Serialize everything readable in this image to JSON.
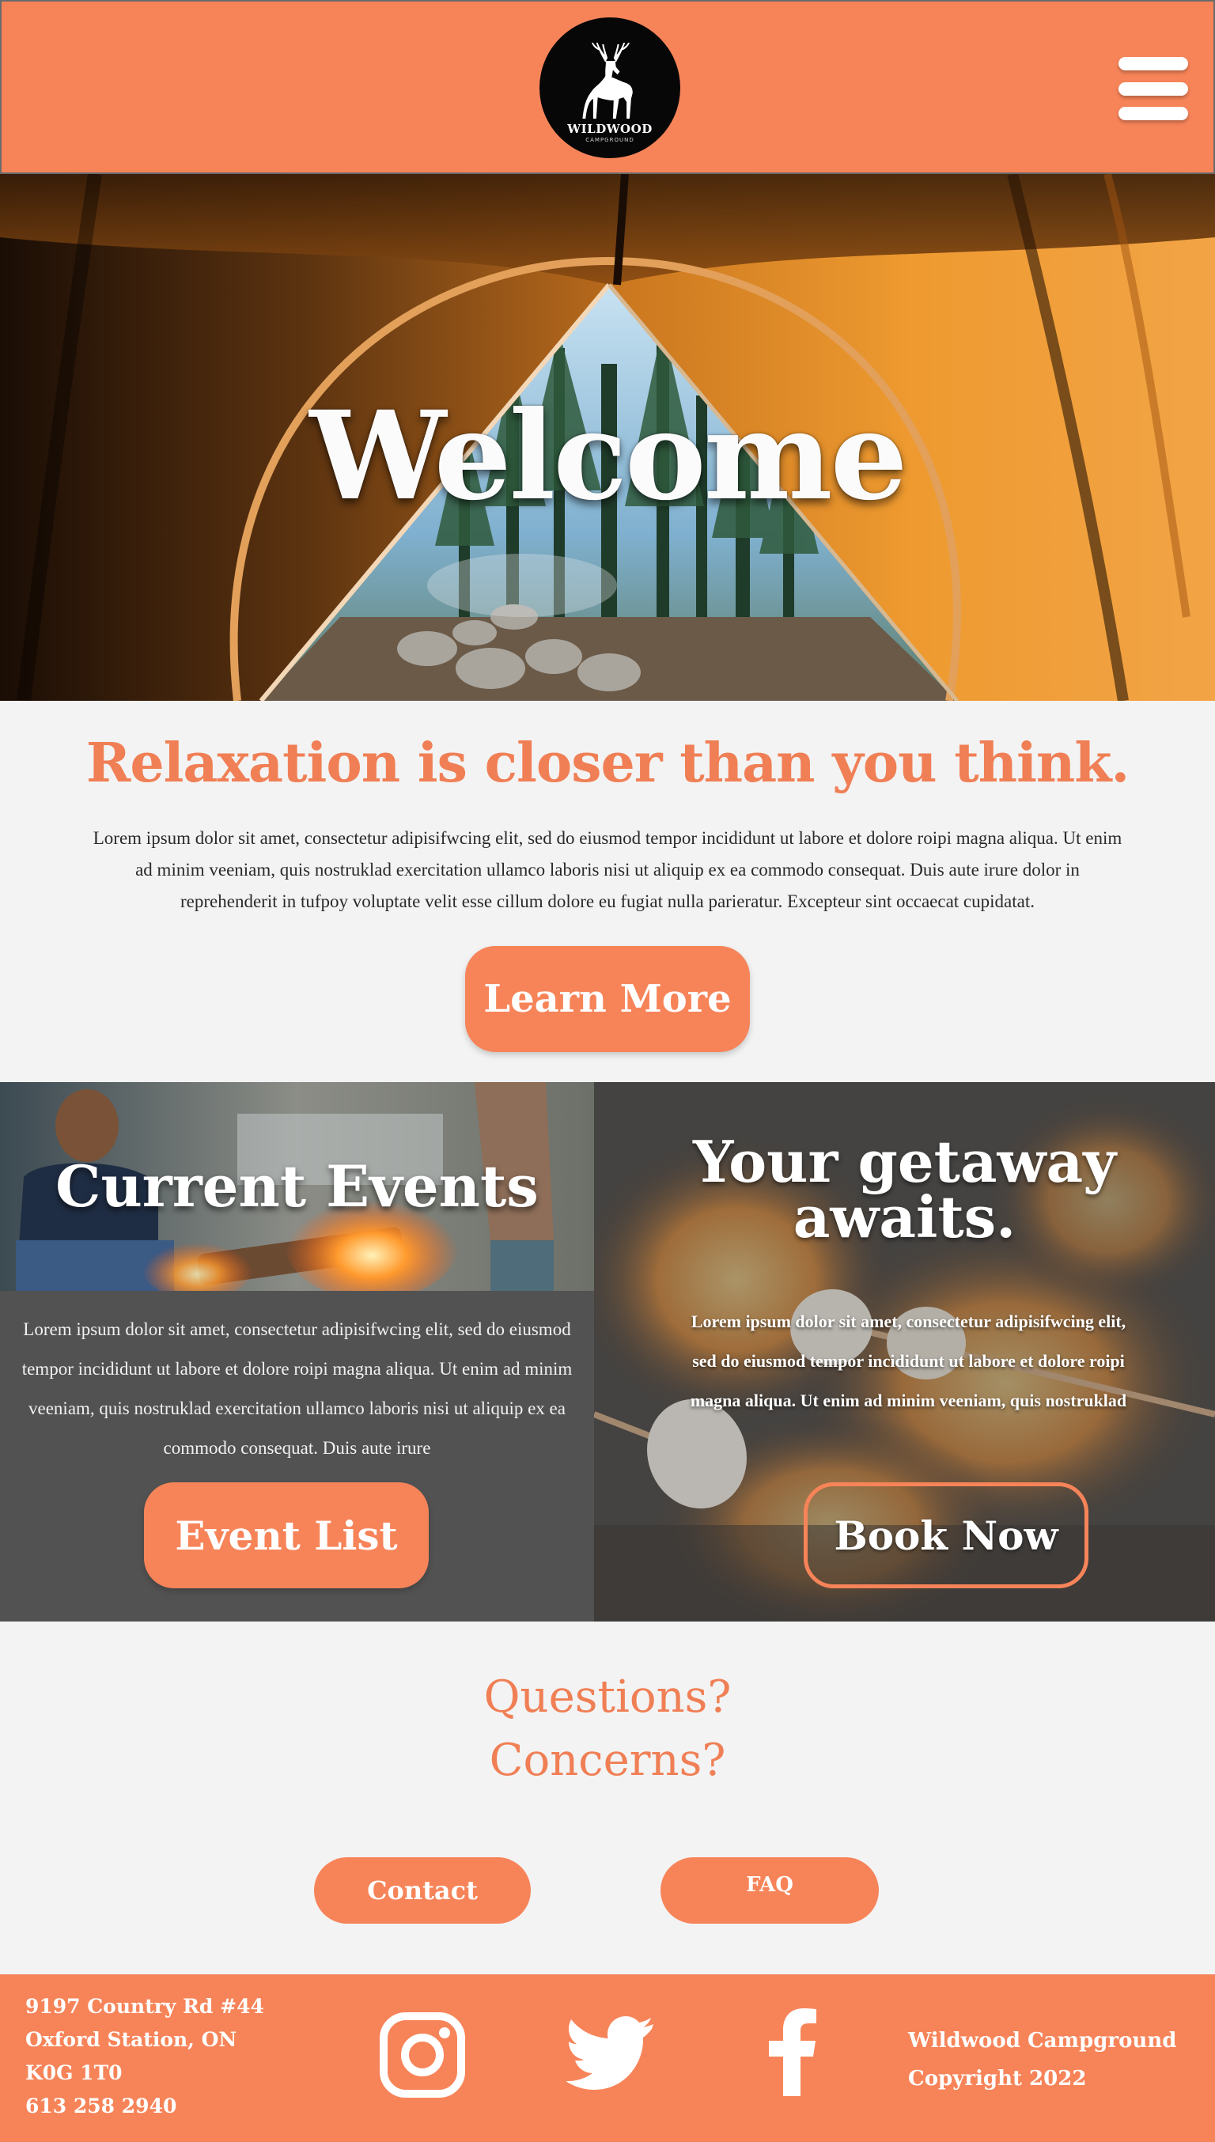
{
  "header": {
    "logo_name": "WILDWOOD",
    "logo_sub": "CAMPGROUND",
    "menu_icon": "hamburger-menu-icon"
  },
  "hero": {
    "title": "Welcome"
  },
  "intro": {
    "heading": "Relaxation is closer than you think.",
    "text": "Lorem ipsum dolor sit amet, consectetur adipisifwcing elit, sed do eiusmod tempor incididunt ut labore et dolore roipi magna aliqua. Ut enim ad minim veeniam, quis nostruklad exercitation ullamco laboris nisi ut aliquip ex ea commodo consequat. Duis aute irure dolor in reprehenderit in tufpoy voluptate velit esse cillum dolore eu fugiat nulla parieratur. Excepteur sint occaecat cupidatat.",
    "button": "Learn More"
  },
  "events": {
    "title": "Current Events",
    "text": "Lorem ipsum dolor sit amet, consectetur adipisifwcing elit, sed do eiusmod tempor incididunt ut labore et dolore roipi magna aliqua. Ut enim ad minim veeniam, quis nostruklad exercitation ullamco laboris nisi ut aliquip ex ea commodo consequat. Duis aute irure",
    "button": "Event List"
  },
  "getaway": {
    "title_line1": "Your getaway",
    "title_line2": "awaits.",
    "text": "Lorem ipsum dolor sit amet, consectetur adipisifwcing elit, sed do eiusmod tempor incididunt ut labore et dolore roipi magna aliqua. Ut enim ad minim veeniam, quis nostruklad",
    "button": "Book Now"
  },
  "questions": {
    "line1": "Questions?",
    "line2": "Concerns?",
    "contact_button": "Contact",
    "faq_button": "FAQ"
  },
  "footer": {
    "address_line1": "9197 Country Rd #44",
    "address_line2": "Oxford Station, ON",
    "address_line3": "K0G 1T0",
    "phone": "613 258 2940",
    "social": [
      "instagram-icon",
      "twitter-icon",
      "facebook-icon"
    ],
    "company": "Wildwood Campground",
    "copyright": "Copyright 2022"
  },
  "colors": {
    "brand_orange": "#f78459",
    "heading_orange": "#f07f55",
    "panel_gray": "#525252",
    "page_bg": "#f3f3f3"
  }
}
